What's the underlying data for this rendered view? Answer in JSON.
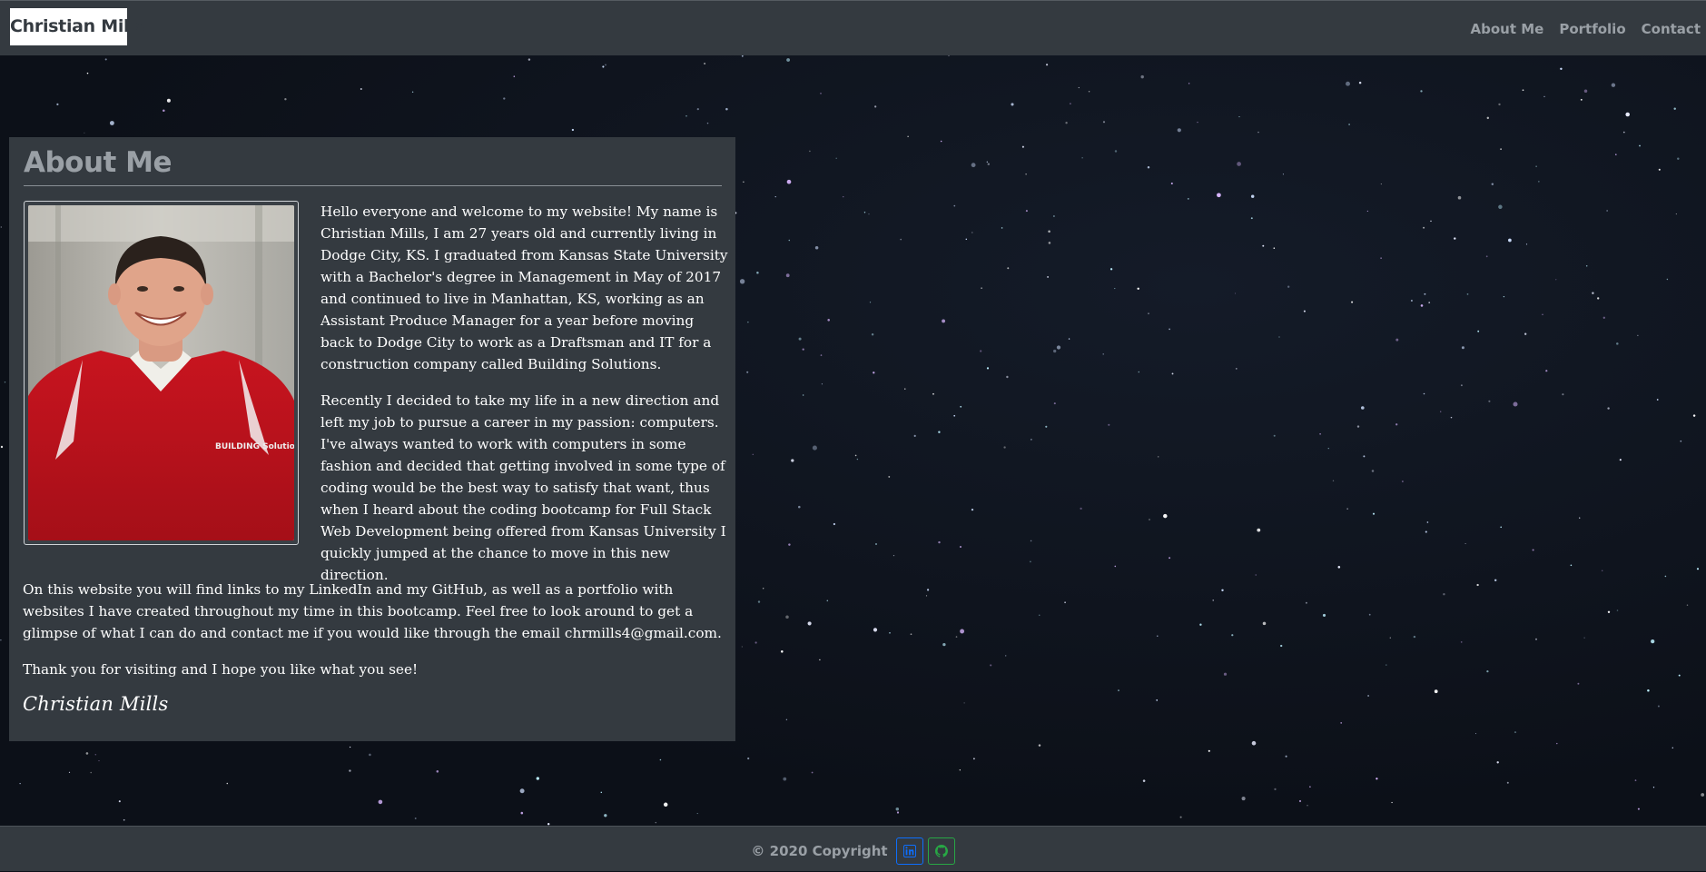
{
  "navbar": {
    "brand": "Christian Mills",
    "links": [
      "About Me",
      "Portfolio",
      "Contact"
    ]
  },
  "about": {
    "title": "About Me",
    "paragraphs": [
      "Hello everyone and welcome to my website! My name is Christian Mills, I am 27 years old and currently living in Dodge City, KS. I graduated from Kansas State University with a Bachelor's degree in Management in May of 2017 and continued to live in Manhattan, KS, working as an Assistant Produce Manager for a year before moving back to Dodge City to work as a Draftsman and IT for a construction company called Building Solutions.",
      "Recently I decided to take my life in a new direction and left my job to pursue a career in my passion: computers. I've always wanted to work with computers in some fashion and decided that getting involved in some type of coding would be the best way to satisfy that want, thus when I heard about the coding bootcamp for Full Stack Web Development being offered from Kansas University I quickly jumped at the chance to move in this new direction.",
      "On this website you will find links to my LinkedIn and my GitHub, as well as a portfolio with websites I have created throughout my time in this bootcamp. Feel free to look around to get a glimpse of what I can do and contact me if you would like through the email chrmills4@gmail.com.",
      "Thank you for visiting and I hope you like what you see!"
    ],
    "signature": "Christian Mills",
    "photo_shirt_text": "BUILDING Solutions"
  },
  "footer": {
    "copyright": "© 2020 Copyright"
  },
  "icons": {
    "linkedin": "linkedin-icon",
    "github": "github-icon"
  },
  "colors": {
    "navbar_bg": "#343a40",
    "card_bg": "#343a40",
    "muted_text": "#9aa0a6",
    "linkedin_blue": "#0d6efd",
    "github_green": "#28a745"
  }
}
